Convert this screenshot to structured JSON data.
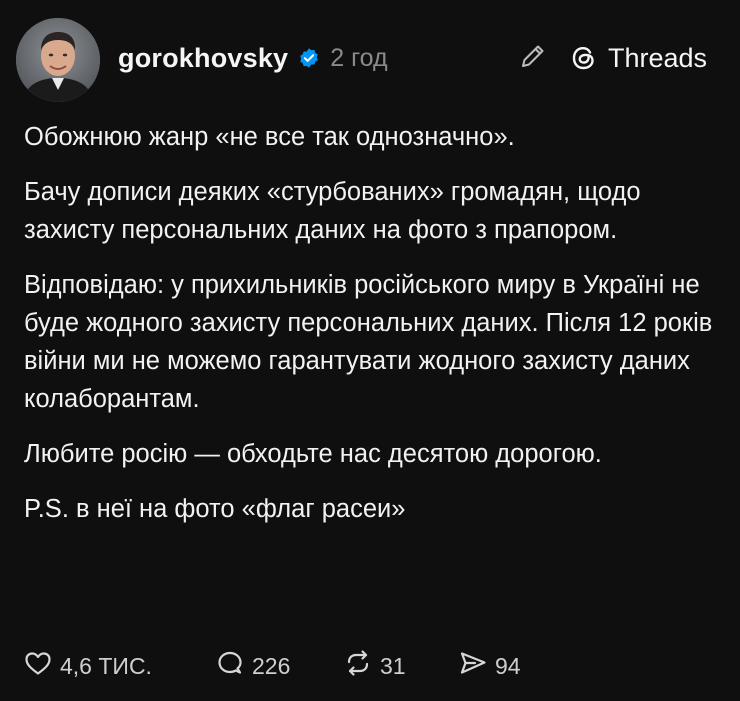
{
  "post": {
    "author": "gorokhovsky",
    "time": "2 год",
    "brand": "Threads",
    "paragraphs": [
      "Обожнюю жанр «не все так однозначно».",
      "Бачу дописи деяких «стурбованих» громадян, щодо захисту персональних даних на фото з прапором.",
      "Відповідаю: у прихильників російського миру в Україні не буде жодного захисту персональних даних. Після 12 років війни ми не можемо гарантувати жодного захисту даних колаборантам.",
      "Любите росію — обходьте нас десятою дорогою.",
      "P.S. в неї на фото «флаг расеи»"
    ],
    "stats": {
      "likes": "4,6 ТИС.",
      "replies": "226",
      "reposts": "31",
      "shares": "94"
    }
  },
  "icons": {
    "verified": "verified-badge-icon",
    "edit": "pencil-icon",
    "brand": "threads-logo-icon",
    "like": "heart-icon",
    "reply": "comment-bubble-icon",
    "repost": "repost-arrows-icon",
    "share": "send-icon"
  },
  "colors": {
    "background": "#0f0f0f",
    "text": "#f2f2f2",
    "muted": "#8a8a8a",
    "verified": "#0095f6"
  }
}
